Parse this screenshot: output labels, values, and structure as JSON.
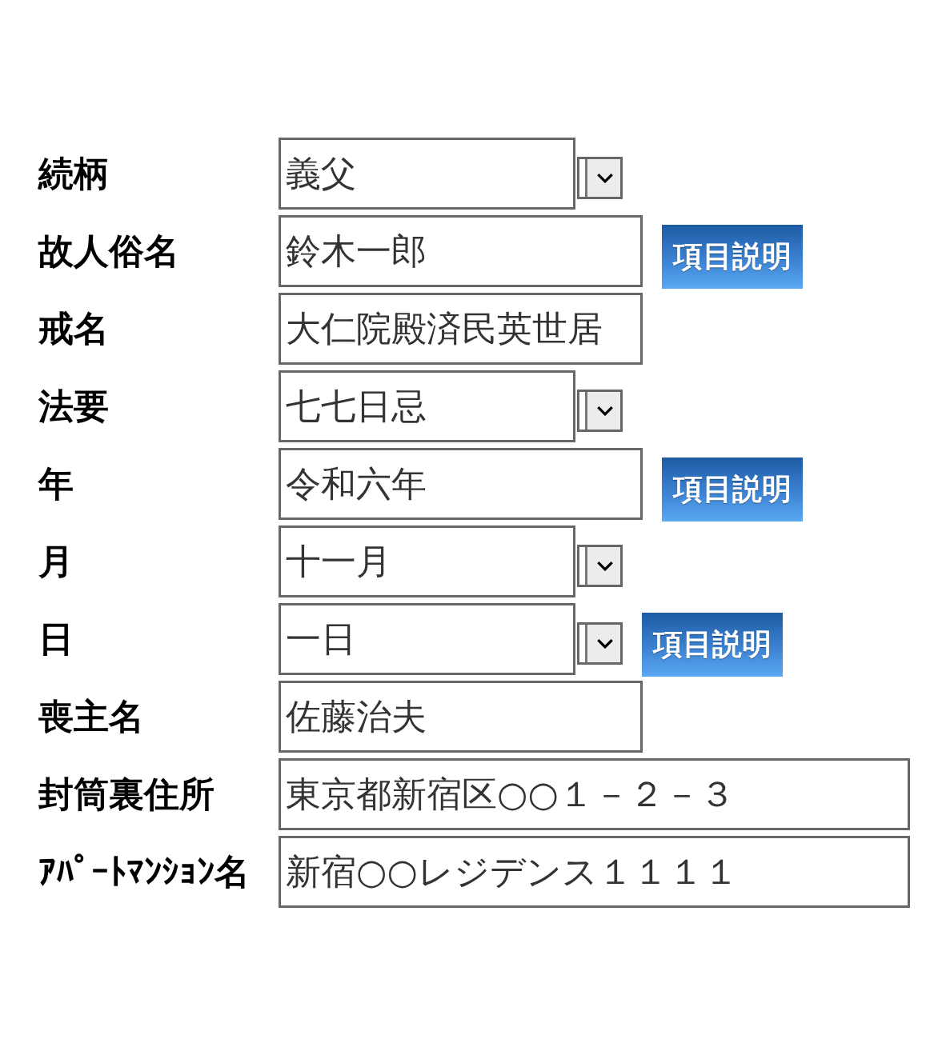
{
  "form": {
    "rows": [
      {
        "label": "続柄",
        "field": {
          "kind": "select",
          "value": "義父"
        }
      },
      {
        "label": "故人俗名",
        "field": {
          "kind": "text",
          "value": "鈴木一郎"
        },
        "help_button": "項目説明"
      },
      {
        "label": "戒名",
        "field": {
          "kind": "text",
          "value": "大仁院殿済民英世居"
        }
      },
      {
        "label": "法要",
        "field": {
          "kind": "select",
          "value": "七七日忌"
        }
      },
      {
        "label": "年",
        "field": {
          "kind": "text",
          "value": "令和六年"
        },
        "help_button": "項目説明"
      },
      {
        "label": "月",
        "field": {
          "kind": "select",
          "value": "十一月"
        }
      },
      {
        "label": "日",
        "field": {
          "kind": "select",
          "value": "一日"
        },
        "help_button": "項目説明"
      },
      {
        "label": "喪主名",
        "field": {
          "kind": "text",
          "value": "佐藤治夫"
        }
      },
      {
        "label": "封筒裏住所",
        "field": {
          "kind": "wide",
          "value": "東京都新宿区○○１－２－３"
        }
      },
      {
        "label": "ｱﾊﾟｰﾄﾏﾝｼｮﾝ名",
        "field": {
          "kind": "wide",
          "value": "新宿○○レジデンス１１１１"
        }
      }
    ]
  }
}
